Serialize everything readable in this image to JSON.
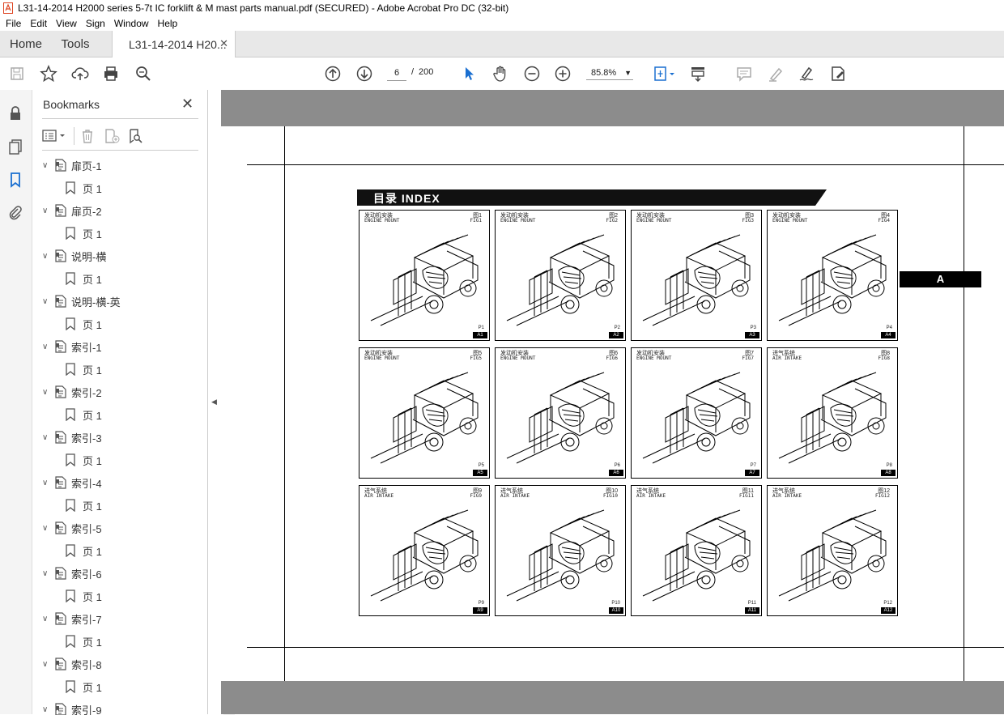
{
  "window": {
    "title": "L31-14-2014 H2000 series 5-7t IC forklift & M mast parts manual.pdf (SECURED) - Adobe Acrobat Pro DC (32-bit)"
  },
  "menu": [
    "File",
    "Edit",
    "View",
    "Sign",
    "Window",
    "Help"
  ],
  "tabs": {
    "home": "Home",
    "tools": "Tools",
    "doc": "L31-14-2014 H20...",
    "close": "✕"
  },
  "toolbar": {
    "page_current": "6",
    "page_sep": "/",
    "page_total": "200",
    "zoom": "85.8%"
  },
  "bookmarks": {
    "title": "Bookmarks",
    "close": "✕",
    "items": [
      {
        "label": "扉页-1",
        "child": "页 1"
      },
      {
        "label": "扉页-2",
        "child": "页 1"
      },
      {
        "label": "说明-横",
        "child": "页 1"
      },
      {
        "label": "说明-横-英",
        "child": "页 1"
      },
      {
        "label": "索引-1",
        "child": "页 1"
      },
      {
        "label": "索引-2",
        "child": "页 1"
      },
      {
        "label": "索引-3",
        "child": "页 1"
      },
      {
        "label": "索引-4",
        "child": "页 1"
      },
      {
        "label": "索引-5",
        "child": "页 1"
      },
      {
        "label": "索引-6",
        "child": "页 1"
      },
      {
        "label": "索引-7",
        "child": "页 1"
      },
      {
        "label": "索引-8",
        "child": "页 1"
      },
      {
        "label": "索引-9",
        "child": ""
      }
    ]
  },
  "document": {
    "index_title": "目录  INDEX",
    "side_tab": "A",
    "figures": [
      {
        "cn": "发动机安装",
        "en": "ENGINE MOUNT",
        "fig_cn": "图1",
        "fig_en": "FIG1",
        "page": "P1",
        "tag": "A1"
      },
      {
        "cn": "发动机安装",
        "en": "ENGINE MOUNT",
        "fig_cn": "图2",
        "fig_en": "FIG2",
        "page": "P2",
        "tag": "A2"
      },
      {
        "cn": "发动机安装",
        "en": "ENGINE MOUNT",
        "fig_cn": "图3",
        "fig_en": "FIG3",
        "page": "P3",
        "tag": "A3"
      },
      {
        "cn": "发动机安装",
        "en": "ENGINE MOUNT",
        "fig_cn": "图4",
        "fig_en": "FIG4",
        "page": "P4",
        "tag": "A4"
      },
      {
        "cn": "发动机安装",
        "en": "ENGINE MOUNT",
        "fig_cn": "图5",
        "fig_en": "FIG5",
        "page": "P5",
        "tag": "A5"
      },
      {
        "cn": "发动机安装",
        "en": "ENGINE MOUNT",
        "fig_cn": "图6",
        "fig_en": "FIG6",
        "page": "P6",
        "tag": "A6"
      },
      {
        "cn": "发动机安装",
        "en": "ENGINE MOUNT",
        "fig_cn": "图7",
        "fig_en": "FIG7",
        "page": "P7",
        "tag": "A7"
      },
      {
        "cn": "进气系统",
        "en": "AIR INTAKE",
        "fig_cn": "图8",
        "fig_en": "FIG8",
        "page": "P8",
        "tag": "A8"
      },
      {
        "cn": "进气系统",
        "en": "AIR INTAKE",
        "fig_cn": "图9",
        "fig_en": "FIG9",
        "page": "P9",
        "tag": "A9"
      },
      {
        "cn": "进气系统",
        "en": "AIR INTAKE",
        "fig_cn": "图10",
        "fig_en": "FIG10",
        "page": "P10",
        "tag": "A10"
      },
      {
        "cn": "进气系统",
        "en": "AIR INTAKE",
        "fig_cn": "图11",
        "fig_en": "FIG11",
        "page": "P11",
        "tag": "A11"
      },
      {
        "cn": "进气系统",
        "en": "AIR INTAKE",
        "fig_cn": "图12",
        "fig_en": "FIG12",
        "page": "P12",
        "tag": "A12"
      }
    ]
  }
}
